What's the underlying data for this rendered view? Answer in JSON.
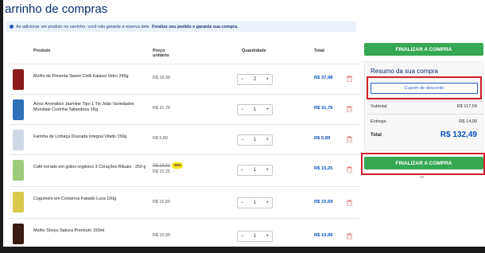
{
  "page": {
    "title": "arrinho de compras"
  },
  "notice": {
    "text": "Ao adicionar um produto no carrinho, você não garante a reserva dele.",
    "bold": "Finalize seu pedido e garanta sua compra."
  },
  "table": {
    "headers": {
      "product": "Produto",
      "unit_price_line1": "Preço",
      "unit_price_line2": "unitário",
      "quantity": "Quantidade",
      "total": "Total"
    },
    "rows": [
      {
        "name": "Molho de Pimenta Sweet Chilli Kalassi Vidro 245g",
        "price": "R$ 18,99",
        "qty": "2",
        "total": "R$ 37,98",
        "thumb_color": "#8b1a1a"
      },
      {
        "name": "Arroz Aromático Jasmine Tipo 1 Tio João Variedades Mundiais Cozinha Tailandesa 1Kg",
        "price": "R$ 31,79",
        "qty": "1",
        "total": "R$ 31,79",
        "thumb_color": "#2f6fb8"
      },
      {
        "name": "Farinha de Linhaça Dourada Integral Vitalin 150g",
        "price": "R$ 5,89",
        "qty": "1",
        "total": "R$ 5,89",
        "thumb_color": "#cfd9e6"
      },
      {
        "name": "Café torrado em grãos orgânico 3 Corações Rituais - 250 g",
        "price_old": "R$ 18,69",
        "discount": "-18%",
        "price": "R$ 15,25",
        "qty": "1",
        "total": "R$ 15,25",
        "thumb_color": "#9ccc7a"
      },
      {
        "name": "Cogumelo em Conserva Fatiado Luca 100g",
        "price": "R$ 15,69",
        "qty": "1",
        "total": "R$ 15,69",
        "thumb_color": "#d9c84a"
      },
      {
        "name": "Molho Shoyu Sakura Premium 150ml",
        "price": "R$ 10,99",
        "qty": "1",
        "total": "R$ 10,99",
        "thumb_color": "#3a1b12"
      }
    ],
    "minus": "−",
    "plus": "+"
  },
  "sidebar": {
    "finalize_label": "FINALIZAR A COMPRA",
    "summary_title": "Resumo da sua compra",
    "coupon_label": "Cupom de desconto",
    "subtotal_label": "Subtotal",
    "subtotal_value": "R$ 117,59",
    "delivery_label": "Entrega",
    "delivery_value": "R$ 14,90",
    "total_label": "Total",
    "total_value": "R$ 132,49",
    "finalize_label_2": "FINALIZAR A COMPRA"
  },
  "colors": {
    "accent_green": "#36a853",
    "link_blue": "#0a4fbf",
    "highlight_red": "#d0202a"
  }
}
